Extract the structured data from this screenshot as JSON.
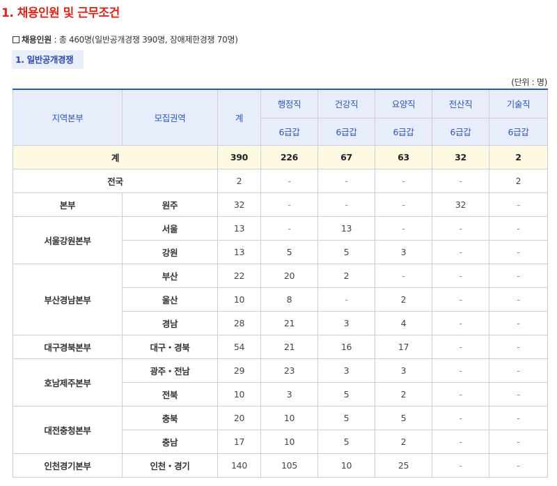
{
  "title": "1. 채용인원 및 근무조건",
  "summary": {
    "label": "채용인원",
    "text": " : 총 460명(일반공개경쟁 390명, 장애제한경쟁 70명)"
  },
  "subtab": "1. 일반공개경쟁",
  "unit": "(단위 : 명)",
  "table": {
    "headers": {
      "region": "지역본부",
      "area": "모집권역",
      "total": "계",
      "jobs": [
        "행정직",
        "건강직",
        "요양직",
        "전산직",
        "기술직"
      ],
      "grades": [
        "6급갑",
        "6급갑",
        "6급갑",
        "6급갑",
        "6급갑"
      ]
    },
    "total_row": {
      "label": "계",
      "values": [
        "390",
        "226",
        "67",
        "63",
        "32",
        "2"
      ]
    },
    "national_row": {
      "label": "전국",
      "values": [
        "2",
        "-",
        "-",
        "-",
        "-",
        "2"
      ]
    },
    "rows": [
      {
        "region": "본부",
        "area": "원주",
        "values": [
          "32",
          "-",
          "-",
          "-",
          "32",
          "-"
        ]
      },
      {
        "region": "서울강원본부",
        "area": "서울",
        "values": [
          "13",
          "-",
          "13",
          "-",
          "-",
          "-"
        ]
      },
      {
        "region": "",
        "area": "강원",
        "values": [
          "13",
          "5",
          "5",
          "3",
          "-",
          "-"
        ]
      },
      {
        "region": "부산경남본부",
        "area": "부산",
        "values": [
          "22",
          "20",
          "2",
          "-",
          "-",
          "-"
        ]
      },
      {
        "region": "",
        "area": "울산",
        "values": [
          "10",
          "8",
          "-",
          "2",
          "-",
          "-"
        ]
      },
      {
        "region": "",
        "area": "경남",
        "values": [
          "28",
          "21",
          "3",
          "4",
          "-",
          "-"
        ]
      },
      {
        "region": "대구경북본부",
        "area": "대구・경북",
        "values": [
          "54",
          "21",
          "16",
          "17",
          "-",
          "-"
        ]
      },
      {
        "region": "호남제주본부",
        "area": "광주・전남",
        "values": [
          "29",
          "23",
          "3",
          "3",
          "-",
          "-"
        ]
      },
      {
        "region": "",
        "area": "전북",
        "values": [
          "10",
          "3",
          "5",
          "2",
          "-",
          "-"
        ]
      },
      {
        "region": "대전충청본부",
        "area": "충북",
        "values": [
          "20",
          "10",
          "5",
          "5",
          "-",
          "-"
        ]
      },
      {
        "region": "",
        "area": "충남",
        "values": [
          "17",
          "10",
          "5",
          "2",
          "-",
          "-"
        ]
      },
      {
        "region": "인천경기본부",
        "area": "인천・경기",
        "values": [
          "140",
          "105",
          "10",
          "25",
          "-",
          "-"
        ]
      }
    ]
  }
}
